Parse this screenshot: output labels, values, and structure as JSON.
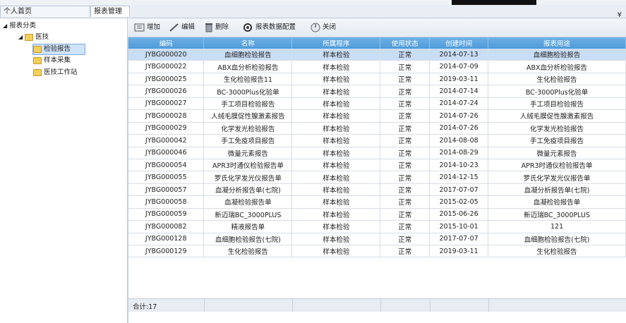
{
  "tabs": [
    {
      "label": "个人首页(QH_HealthCloud)"
    },
    {
      "label": "报表管理",
      "close": "×"
    }
  ],
  "dropdown_glyph": "¥",
  "tree": {
    "root": "报表分类",
    "group": "医技",
    "items": [
      "检验报告",
      "样本采集",
      "医技工作站"
    ]
  },
  "toolbar": {
    "add": "增加",
    "edit": "编辑",
    "delete": "删除",
    "config": "报表数据配置",
    "close": "关闭"
  },
  "table": {
    "headers": [
      "编码",
      "名称",
      "所属程序",
      "使用状态",
      "创建时间",
      "报表用途"
    ],
    "rows": [
      [
        "JYBG000020",
        "血细胞检验报告",
        "样本检验",
        "正常",
        "2014-07-13",
        "血细胞检验报告"
      ],
      [
        "JYBG000022",
        "ABX血分析检验报告",
        "样本检验",
        "正常",
        "2014-07-09",
        "ABX血分析检验报告"
      ],
      [
        "JYBG000025",
        "生化检验报告11",
        "样本检验",
        "正常",
        "2019-03-11",
        "生化检验报告"
      ],
      [
        "JYBG000026",
        "BC-3000Plus化验单",
        "样本检验",
        "正常",
        "2014-07-14",
        "BC-3000Plus化验单"
      ],
      [
        "JYBG000027",
        "手工项目检验报告",
        "样本检验",
        "正常",
        "2014-07-24",
        "手工项目检验报告"
      ],
      [
        "JYBG000028",
        "人绒毛膜促性腺激素报告",
        "样本检验",
        "正常",
        "2014-07-26",
        "人绒毛膜促性腺激素报告"
      ],
      [
        "JYBG000029",
        "化学发光检验报告",
        "样本检验",
        "正常",
        "2014-07-26",
        "化学发光检验报告"
      ],
      [
        "JYBG000042",
        "手工免疫项目报告",
        "样本检验",
        "正常",
        "2014-08-08",
        "手工免疫项目报告"
      ],
      [
        "JYBG000046",
        "微量元素报告",
        "样本检验",
        "正常",
        "2014-08-29",
        "微量元素报告"
      ],
      [
        "JYBG000054",
        "APR3时通仪检验报告单",
        "样本检验",
        "正常",
        "2014-10-23",
        "APR3时通仪检验报告单"
      ],
      [
        "JYBG000055",
        "罗氏化学发光仪报告单",
        "样本检验",
        "正常",
        "2014-12-15",
        "罗氏化学发光仪报告单"
      ],
      [
        "JYBG000057",
        "血凝分析报告单(七院)",
        "样本检验",
        "正常",
        "2017-07-07",
        "血凝分析报告单(七院)"
      ],
      [
        "JYBG000058",
        "血凝检验报告单",
        "样本检验",
        "正常",
        "2015-02-05",
        "血凝检验报告单"
      ],
      [
        "JYBG000059",
        "新迈瑞BC_3000PLUS",
        "样本检验",
        "正常",
        "2015-06-26",
        "新迈瑞BC_3000PLUS"
      ],
      [
        "JYBG000082",
        "精液报告单",
        "样本检验",
        "正常",
        "2015-10-01",
        "121"
      ],
      [
        "JYBG000128",
        "血细胞检验报告(七院)",
        "样本检验",
        "正常",
        "2017-07-07",
        "血细胞检验报告(七院)"
      ],
      [
        "JYBG000129",
        "生化检验报告",
        "样本检验",
        "正常",
        "2019-03-11",
        "生化检验报告"
      ]
    ],
    "footer": "合计:17"
  }
}
